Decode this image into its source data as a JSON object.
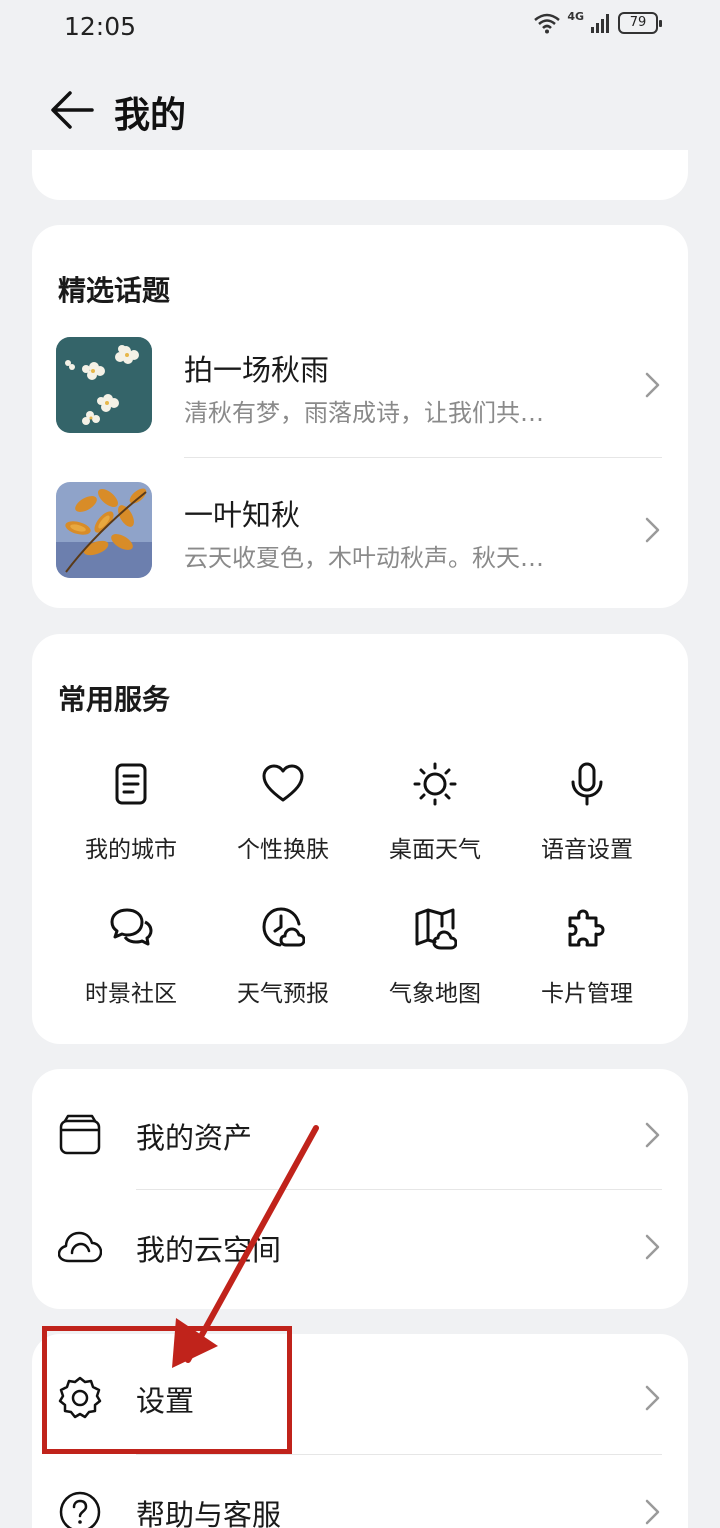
{
  "status_bar": {
    "time": "12:05",
    "network": "4G",
    "battery": "79"
  },
  "header": {
    "title": "我的"
  },
  "topics": {
    "title": "精选话题",
    "items": [
      {
        "title": "拍一场秋雨",
        "desc": "清秋有梦，雨落成诗，让我们共…"
      },
      {
        "title": "一叶知秋",
        "desc": "云天收夏色，木叶动秋声。秋天…"
      }
    ]
  },
  "services": {
    "title": "常用服务",
    "items": [
      {
        "label": "我的城市",
        "icon": "document-icon"
      },
      {
        "label": "个性换肤",
        "icon": "heart-icon"
      },
      {
        "label": "桌面天气",
        "icon": "sun-icon"
      },
      {
        "label": "语音设置",
        "icon": "microphone-icon"
      },
      {
        "label": "时景社区",
        "icon": "chat-bubbles-icon"
      },
      {
        "label": "天气预报",
        "icon": "forecast-icon"
      },
      {
        "label": "气象地图",
        "icon": "map-icon"
      },
      {
        "label": "卡片管理",
        "icon": "puzzle-icon"
      }
    ]
  },
  "assets": {
    "items": [
      {
        "label": "我的资产",
        "icon": "wallet-icon"
      },
      {
        "label": "我的云空间",
        "icon": "cloud-icon"
      }
    ]
  },
  "settings_group": {
    "items": [
      {
        "label": "设置",
        "icon": "gear-icon"
      },
      {
        "label": "帮助与客服",
        "icon": "help-icon"
      }
    ]
  },
  "colors": {
    "background": "#f0f1f3",
    "card": "#ffffff",
    "annotation": "#c0231b"
  }
}
